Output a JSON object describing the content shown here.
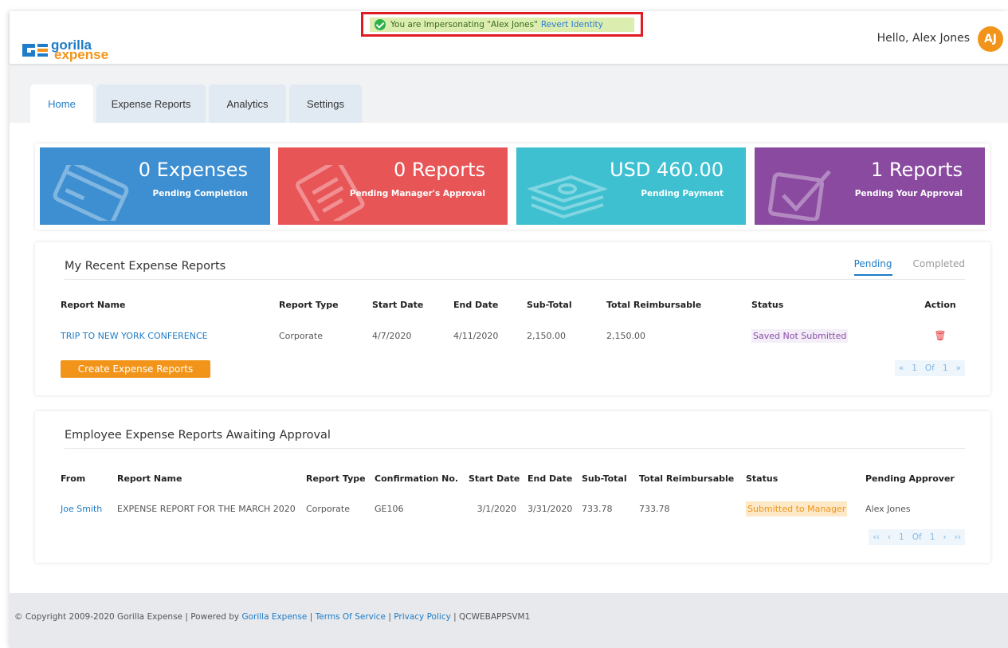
{
  "header": {
    "logo_line1": "gorilla",
    "logo_line2": "expense",
    "impersonation_text": "You are Impersonating \"Alex Jones\"",
    "revert_label": "Revert Identity",
    "greeting": "Hello, Alex Jones",
    "avatar_initials": "AJ"
  },
  "tabs": [
    {
      "label": "Home",
      "active": true
    },
    {
      "label": "Expense Reports",
      "active": false
    },
    {
      "label": "Analytics",
      "active": false
    },
    {
      "label": "Settings",
      "active": false
    }
  ],
  "cards": [
    {
      "value": "0 Expenses",
      "label": "Pending Completion",
      "color": "#3d8fd1",
      "icon": "credit-card-icon"
    },
    {
      "value": "0 Reports",
      "label": "Pending Manager's Approval",
      "color": "#e85557",
      "icon": "document-icon"
    },
    {
      "value": "USD 460.00",
      "label": "Pending Payment",
      "color": "#3ec0d1",
      "icon": "money-stack-icon"
    },
    {
      "value": "1 Reports",
      "label": "Pending Your Approval",
      "color": "#8a4aa0",
      "icon": "checkbox-icon"
    }
  ],
  "recent": {
    "title": "My Recent Expense Reports",
    "tab_pending": "Pending",
    "tab_completed": "Completed",
    "columns": [
      "Report Name",
      "Report Type",
      "Start Date",
      "End Date",
      "Sub-Total",
      "Total Reimbursable",
      "Status",
      "Action"
    ],
    "rows": [
      {
        "name": "TRIP TO NEW YORK CONFERENCE",
        "type": "Corporate",
        "start": "4/7/2020",
        "end": "4/11/2020",
        "subtotal": "2,150.00",
        "total": "2,150.00",
        "status": "Saved Not Submitted"
      }
    ],
    "create_label": "Create Expense Reports",
    "pager": {
      "first": "«",
      "page": "1",
      "of": "Of",
      "total": "1",
      "last": "»"
    }
  },
  "awaiting": {
    "title": "Employee Expense Reports Awaiting Approval",
    "columns": [
      "From",
      "Report Name",
      "Report Type",
      "Confirmation No.",
      "Start Date",
      "End Date",
      "Sub-Total",
      "Total Reimbursable",
      "Status",
      "Pending Approver"
    ],
    "rows": [
      {
        "from": "Joe Smith",
        "name": "EXPENSE REPORT FOR THE MARCH 2020",
        "type": "Corporate",
        "conf": "GE106",
        "start": "3/1/2020",
        "end": "3/31/2020",
        "subtotal": "733.78",
        "total": "733.78",
        "status": "Submitted to Manager",
        "approver": "Alex Jones"
      }
    ],
    "pager": {
      "first": "‹‹",
      "prev": "‹",
      "page": "1",
      "of": "Of",
      "total": "1",
      "next": "›",
      "last": "››"
    }
  },
  "footer": {
    "copyright": "Copyright 2009-2020 Gorilla Expense | Powered by",
    "powered_link": "Gorilla Expense",
    "sep1": "|",
    "terms": "Terms Of Service",
    "sep2": "|",
    "privacy": "Privacy Policy",
    "server": "| QCWEBAPPSVM1"
  }
}
